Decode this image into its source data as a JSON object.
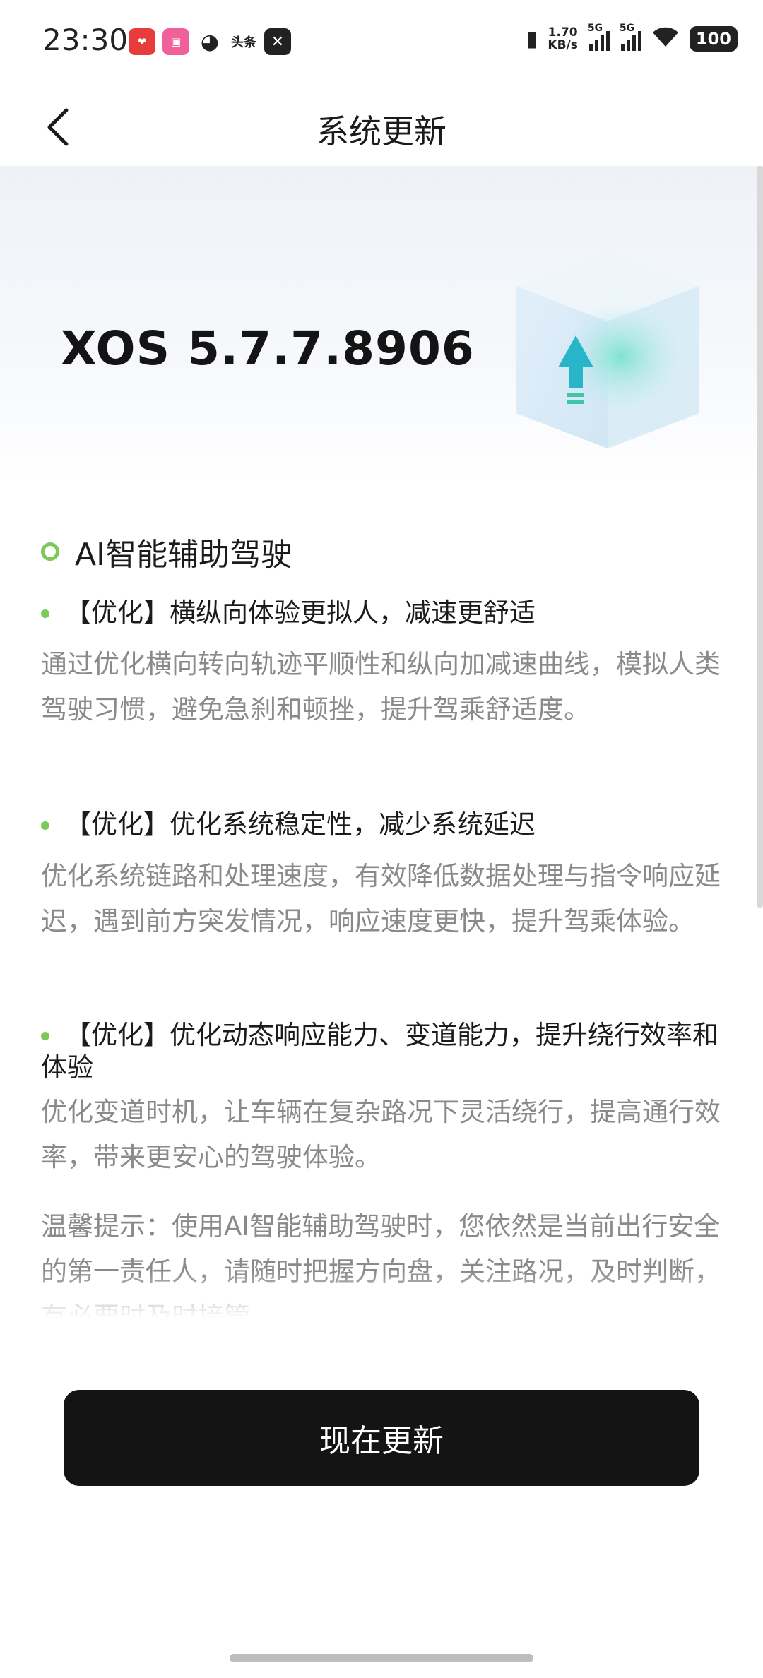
{
  "status_bar": {
    "time": "23:30",
    "app_icons": [
      "xiaohongshu-icon",
      "bilibili-icon",
      "weibo-icon",
      "toutiao-icon",
      "capcut-icon"
    ],
    "toutiao_label": "头条",
    "net_speed_value": "1.70",
    "net_speed_unit": "KB/s",
    "sim1_label": "5G",
    "sim2_label": "5G",
    "battery": "100"
  },
  "header": {
    "title": "系统更新"
  },
  "hero": {
    "version": "XOS 5.7.7.8906"
  },
  "release_notes": {
    "section_title": "AI智能辅助驾驶",
    "items": [
      {
        "title": "【优化】横纵向体验更拟人，减速更舒适",
        "body": "通过优化横向转向轨迹平顺性和纵向加减速曲线，模拟人类驾驶习惯，避免急刹和顿挫，提升驾乘舒适度。"
      },
      {
        "title": "【优化】优化系统稳定性，减少系统延迟",
        "body": "优化系统链路和处理速度，有效降低数据处理与指令响应延迟，遇到前方突发情况，响应速度更快，提升驾乘体验。"
      },
      {
        "title": "【优化】优化动态响应能力、变道能力，提升绕行效率和体验",
        "body": "优化变道时机，让车辆在复杂路况下灵活绕行，提高通行效率，带来更安心的驾驶体验。"
      }
    ],
    "tip": "温馨提示：使用AI智能辅助驾驶时，您依然是当前出行安全的第一责任人，请随时把握方向盘，关注路况，及时判断，有必要时及时接管。"
  },
  "actions": {
    "update_now": "现在更新"
  },
  "colors": {
    "accent_green": "#7cc85a",
    "button_bg": "#141414",
    "body_text": "#8a8a8a"
  }
}
